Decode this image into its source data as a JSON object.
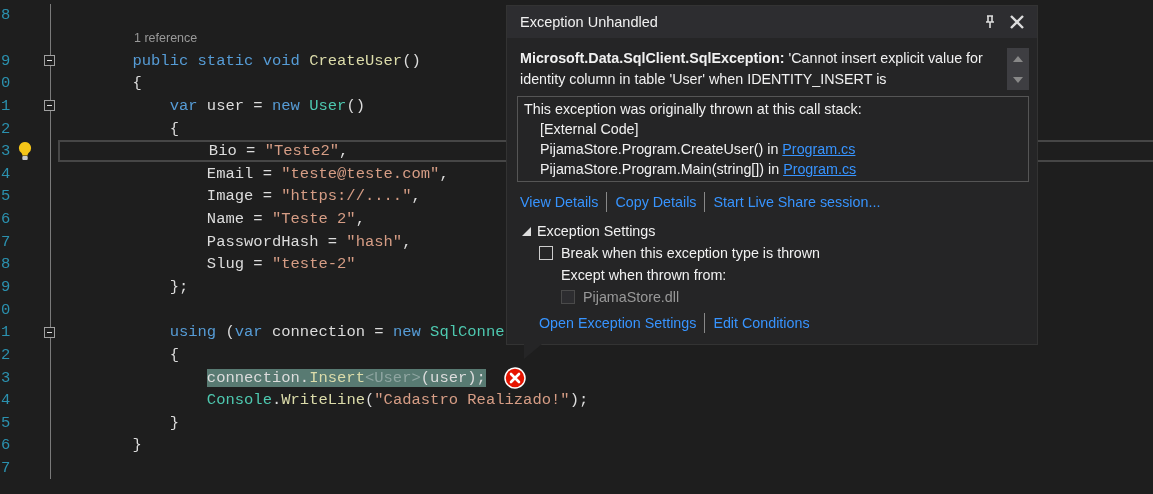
{
  "editor": {
    "lines": [
      {
        "kind": "code",
        "number": "8",
        "fold": false,
        "current": false,
        "selected": false,
        "lightbulb": false,
        "error": false
      },
      {
        "kind": "codelens",
        "text": "1 reference"
      },
      {
        "kind": "code",
        "number": "9",
        "fold": true,
        "current": false,
        "selected": false,
        "lightbulb": false,
        "error": false,
        "tokens": [
          {
            "text": "        public static void ",
            "kind": "keyword"
          },
          {
            "text": "CreateUser",
            "kind": "method"
          },
          {
            "text": "()",
            "kind": "plain"
          }
        ]
      },
      {
        "kind": "code",
        "number": "0",
        "fold": false,
        "current": false,
        "selected": false,
        "lightbulb": false,
        "error": false,
        "tokens": [
          {
            "text": "        {",
            "kind": "plain"
          }
        ]
      },
      {
        "kind": "code",
        "number": "1",
        "fold": true,
        "current": false,
        "selected": false,
        "lightbulb": false,
        "error": false,
        "tokens": [
          {
            "text": "            var ",
            "kind": "keyword"
          },
          {
            "text": "user = ",
            "kind": "plain"
          },
          {
            "text": "new ",
            "kind": "keyword"
          },
          {
            "text": "User",
            "kind": "type"
          },
          {
            "text": "()",
            "kind": "plain"
          }
        ]
      },
      {
        "kind": "code",
        "number": "2",
        "fold": false,
        "current": false,
        "selected": false,
        "lightbulb": false,
        "error": false,
        "tokens": [
          {
            "text": "            {",
            "kind": "plain"
          }
        ]
      },
      {
        "kind": "code",
        "number": "3",
        "fold": false,
        "current": true,
        "selected": false,
        "lightbulb": true,
        "error": false,
        "tokens": [
          {
            "text": "                Bio = ",
            "kind": "plain"
          },
          {
            "text": "\"Teste2\"",
            "kind": "string"
          },
          {
            "text": ",",
            "kind": "plain"
          }
        ]
      },
      {
        "kind": "code",
        "number": "4",
        "fold": false,
        "current": false,
        "selected": false,
        "lightbulb": false,
        "error": false,
        "tokens": [
          {
            "text": "                Email = ",
            "kind": "plain"
          },
          {
            "text": "\"teste@teste.com\"",
            "kind": "string"
          },
          {
            "text": ",",
            "kind": "plain"
          }
        ]
      },
      {
        "kind": "code",
        "number": "5",
        "fold": false,
        "current": false,
        "selected": false,
        "lightbulb": false,
        "error": false,
        "tokens": [
          {
            "text": "                Image = ",
            "kind": "plain"
          },
          {
            "text": "\"https://....\"",
            "kind": "string"
          },
          {
            "text": ",",
            "kind": "plain"
          }
        ]
      },
      {
        "kind": "code",
        "number": "6",
        "fold": false,
        "current": false,
        "selected": false,
        "lightbulb": false,
        "error": false,
        "tokens": [
          {
            "text": "                Name = ",
            "kind": "plain"
          },
          {
            "text": "\"Teste 2\"",
            "kind": "string"
          },
          {
            "text": ",",
            "kind": "plain"
          }
        ]
      },
      {
        "kind": "code",
        "number": "7",
        "fold": false,
        "current": false,
        "selected": false,
        "lightbulb": false,
        "error": false,
        "tokens": [
          {
            "text": "                PasswordHash = ",
            "kind": "plain"
          },
          {
            "text": "\"hash\"",
            "kind": "string"
          },
          {
            "text": ",",
            "kind": "plain"
          }
        ]
      },
      {
        "kind": "code",
        "number": "8",
        "fold": false,
        "current": false,
        "selected": false,
        "lightbulb": false,
        "error": false,
        "tokens": [
          {
            "text": "                Slug = ",
            "kind": "plain"
          },
          {
            "text": "\"teste-2\"",
            "kind": "string"
          }
        ]
      },
      {
        "kind": "code",
        "number": "9",
        "fold": false,
        "current": false,
        "selected": false,
        "lightbulb": false,
        "error": false,
        "tokens": [
          {
            "text": "            };",
            "kind": "plain"
          }
        ]
      },
      {
        "kind": "code",
        "number": "0",
        "fold": false,
        "current": false,
        "selected": false,
        "lightbulb": false,
        "error": false
      },
      {
        "kind": "code",
        "number": "1",
        "fold": true,
        "current": false,
        "selected": false,
        "lightbulb": false,
        "error": false,
        "tokens": [
          {
            "text": "            using ",
            "kind": "keyword"
          },
          {
            "text": "(",
            "kind": "plain"
          },
          {
            "text": "var ",
            "kind": "keyword"
          },
          {
            "text": "connection = ",
            "kind": "plain"
          },
          {
            "text": "new ",
            "kind": "keyword"
          },
          {
            "text": "SqlConne",
            "kind": "type"
          }
        ]
      },
      {
        "kind": "code",
        "number": "2",
        "fold": false,
        "current": false,
        "selected": false,
        "lightbulb": false,
        "error": false,
        "tokens": [
          {
            "text": "            {",
            "kind": "plain"
          }
        ]
      },
      {
        "kind": "code",
        "number": "3",
        "fold": false,
        "current": false,
        "selected": true,
        "lightbulb": false,
        "error": true,
        "tokens": [
          {
            "text": "                connection.",
            "kind": "plain"
          },
          {
            "text": "Insert",
            "kind": "method"
          },
          {
            "text": "<User>",
            "kind": "dimmed"
          },
          {
            "text": "(user);",
            "kind": "plain"
          }
        ]
      },
      {
        "kind": "code",
        "number": "4",
        "fold": false,
        "current": false,
        "selected": false,
        "lightbulb": false,
        "error": false,
        "tokens": [
          {
            "text": "                Console",
            "kind": "type"
          },
          {
            "text": ".",
            "kind": "plain"
          },
          {
            "text": "WriteLine",
            "kind": "method"
          },
          {
            "text": "(",
            "kind": "plain"
          },
          {
            "text": "\"Cadastro Realizado!\"",
            "kind": "string"
          },
          {
            "text": ");",
            "kind": "plain"
          }
        ]
      },
      {
        "kind": "code",
        "number": "5",
        "fold": false,
        "current": false,
        "selected": false,
        "lightbulb": false,
        "error": false,
        "tokens": [
          {
            "text": "            }",
            "kind": "plain"
          }
        ]
      },
      {
        "kind": "code",
        "number": "6",
        "fold": false,
        "current": false,
        "selected": false,
        "lightbulb": false,
        "error": false,
        "tokens": [
          {
            "text": "        }",
            "kind": "plain"
          }
        ]
      },
      {
        "kind": "code",
        "number": "7",
        "fold": false,
        "current": false,
        "selected": false,
        "lightbulb": false,
        "error": false
      }
    ]
  },
  "popup": {
    "title": "Exception Unhandled",
    "message": "**Microsoft.Data.SqlClient.SqlException:** 'Cannot insert explicit value for identity column in table 'User' when IDENTITY_INSERT is",
    "call_stack": {
      "heading": "This exception was originally thrown at this call stack:",
      "frames": [
        {
          "text": "[External Code]"
        },
        {
          "text": "PijamaStore.Program.CreateUser() in ",
          "link": "Program.cs"
        },
        {
          "text": "PijamaStore.Program.Main(string[]) in ",
          "link": "Program.cs"
        }
      ]
    },
    "links": [
      "View Details",
      "Copy Details",
      "Start Live Share session..."
    ],
    "settings": {
      "label": "Exception Settings",
      "expanded": true,
      "break_option": {
        "label": "Break when this exception type is thrown",
        "checked": false
      },
      "except_label": "Except when thrown from:",
      "modules": [
        {
          "label": "PijamaStore.dll",
          "checked": false,
          "disabled": true
        }
      ],
      "links": [
        "Open Exception Settings",
        "Edit Conditions"
      ]
    }
  }
}
